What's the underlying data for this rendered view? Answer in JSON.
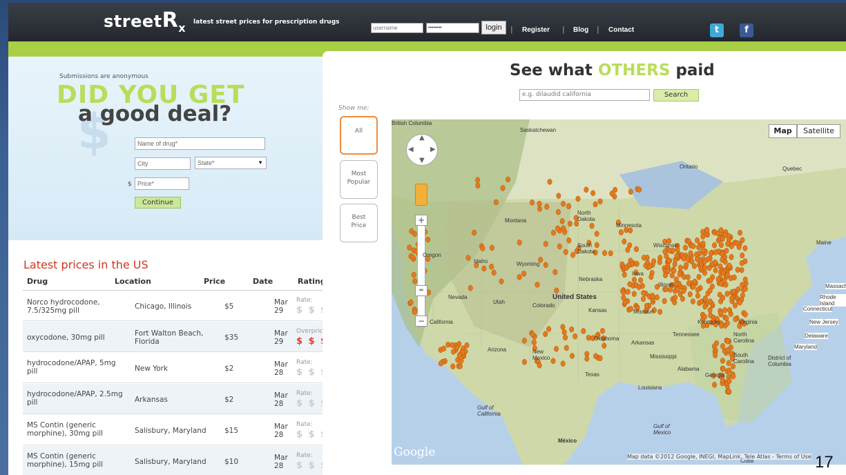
{
  "header": {
    "logo_street": "street",
    "logo_r": "R",
    "logo_x": "x",
    "tagline": "latest street prices for prescription drugs",
    "username_placeholder": "username",
    "password_placeholder": "••••••••",
    "login_label": "login",
    "nav": [
      "Register",
      "Blog",
      "Contact"
    ]
  },
  "form": {
    "anon_text": "Submissions are anonymous",
    "headline1": "DID YOU GET",
    "headline2": "a good deal?",
    "drug_placeholder": "Name of drug*",
    "city_placeholder": "City",
    "state_placeholder": "State*",
    "price_currency": "$",
    "price_placeholder": "Price*",
    "continue_label": "Continue"
  },
  "latest": {
    "title": "Latest prices in the US",
    "columns": [
      "Drug",
      "Location",
      "Price",
      "Date",
      "Rating"
    ],
    "rows": [
      {
        "drug": "Norco hydrocodone, 7.5/325mg pill",
        "location": "Chicago, Illinois",
        "price": "$5",
        "month": "Mar",
        "day": "29",
        "rate_label": "Rate:",
        "rating": "$ $ $ $ $"
      },
      {
        "drug": "oxycodone, 30mg pill",
        "location": "Fort Walton Beach, Florida",
        "price": "$35",
        "month": "Mar",
        "day": "29",
        "rate_label": "Overpriced",
        "rating": "$ $ $ $ $"
      },
      {
        "drug": "hydrocodone/APAP, 5mg pill",
        "location": "New York",
        "price": "$2",
        "month": "Mar",
        "day": "28",
        "rate_label": "Rate:",
        "rating": "$ $ $ $ $"
      },
      {
        "drug": "hydrocodone/APAP, 2.5mg pill",
        "location": "Arkansas",
        "price": "$2",
        "month": "Mar",
        "day": "28",
        "rate_label": "Rate:",
        "rating": "$ $ $ $ $"
      },
      {
        "drug": "MS Contin (generic morphine), 30mg pill",
        "location": "Salisbury, Maryland",
        "price": "$15",
        "month": "Mar",
        "day": "28",
        "rate_label": "Rate:",
        "rating": "$ $ $ $ $"
      },
      {
        "drug": "MS Contin (generic morphine), 15mg pill",
        "location": "Salisbury, Maryland",
        "price": "$10",
        "month": "Mar",
        "day": "28",
        "rate_label": "Rate:",
        "rating": "$ $ $ $ $"
      }
    ]
  },
  "search": {
    "title_pre": "See what",
    "title_highlight": "OTHERS",
    "title_post": "paid",
    "placeholder": "e.g. dilaudid california",
    "button": "Search",
    "show_me": "Show me:",
    "filters": [
      {
        "line1": "All",
        "line2": ""
      },
      {
        "line1": "Most",
        "line2": "Popular"
      },
      {
        "line1": "Best",
        "line2": "Price"
      }
    ]
  },
  "map": {
    "map_button": "Map",
    "satellite_button": "Satellite",
    "labels": {
      "british_columbia": "British Columbia",
      "saskatchewan": "Saskatchewan",
      "ontario": "Ontario",
      "quebec": "Quebec",
      "montana": "Montana",
      "north_dakota": "North Dakota",
      "minnesota": "Minnesota",
      "oregon": "Oregon",
      "idaho": "Idaho",
      "wyoming": "Wyoming",
      "south_dakota": "South Dakota",
      "wisconsin": "Wisconsin",
      "nebraska": "Nebraska",
      "iowa": "Iowa",
      "illinois": "Illinois",
      "nevada": "Nevada",
      "utah": "Utah",
      "colorado": "Colorado",
      "united_states": "United States",
      "kansas": "Kansas",
      "missouri": "Missouri",
      "california": "California",
      "oklahoma": "Oklahoma",
      "arkansas": "Arkansas",
      "arizona": "Arizona",
      "new_mexico": "New Mexico",
      "texas": "Texas",
      "mississippi": "Mississippi",
      "alabama": "Alabama",
      "georgia": "Georgia",
      "louisiana": "Louisiana",
      "tennessee": "Tennessee",
      "kentucky": "Kentucky",
      "virginia": "Virginia",
      "north_carolina": "North Carolina",
      "south_carolina": "South Carolina",
      "gulf_california": "Gulf of California",
      "gulf_mexico": "Gulf of Mexico",
      "mexico": "México",
      "cuba": "Cuba",
      "maine": "Maine",
      "massachusetts": "Massachusetts",
      "rhode_island": "Rhode Island",
      "connecticut": "Connecticut",
      "new_jersey": "New Jersey",
      "delaware": "Delaware",
      "maryland": "Maryland",
      "district_columbia": "District of Columbia"
    },
    "google_logo": "Google",
    "attribution": "Map data ©2012 Google, INEGI, MapLink, Tele Atlas - Terms of Use"
  },
  "page_number": "17"
}
